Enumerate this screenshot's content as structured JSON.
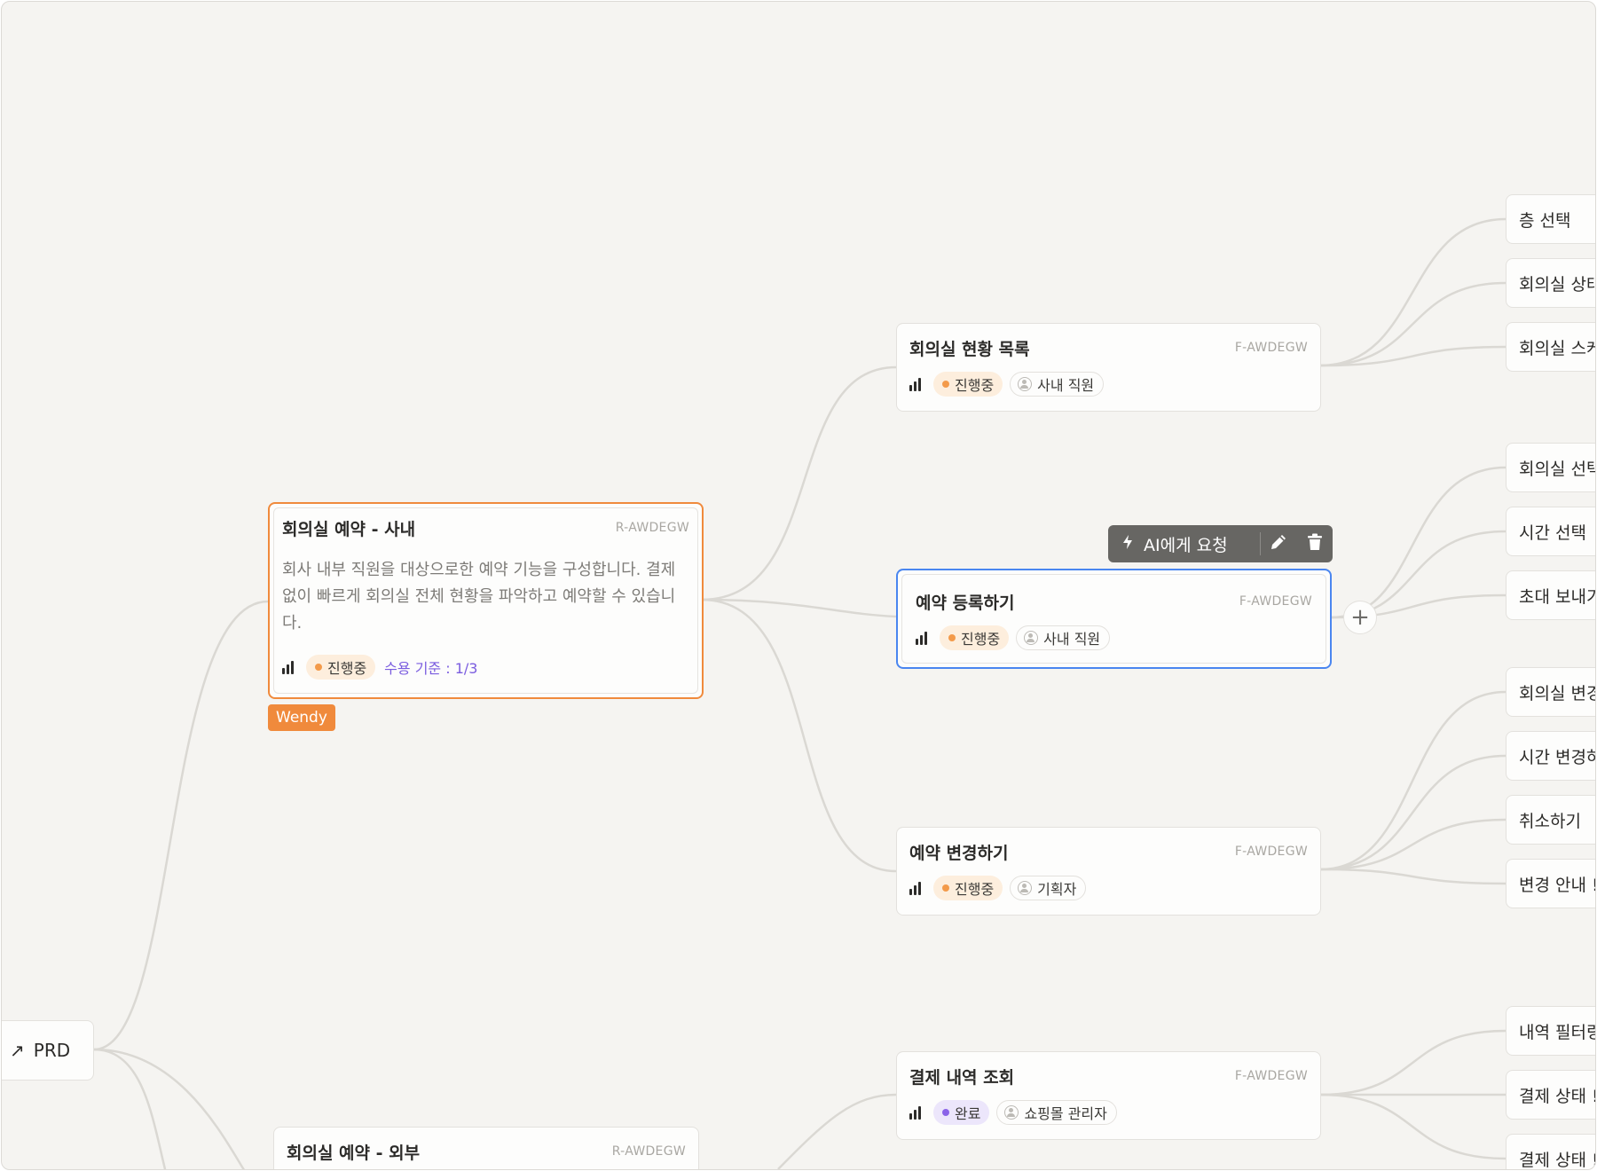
{
  "root": {
    "label": "PRD",
    "arrow_icon": "↗"
  },
  "requirements": [
    {
      "title": "회의실 예약 - 사내",
      "code": "R-AWDEGW",
      "description": "회사 내부 직원을 대상으로한 예약 기능을 구성합니다. 결제 없이 빠르게 회의실 전체 현황을 파악하고 예약할 수 있습니다.",
      "status": "진행중",
      "acceptance": "수용 기준 : 1/3",
      "assignee": "Wendy"
    },
    {
      "title": "회의실 예약 - 외부",
      "code": "R-AWDEGW"
    }
  ],
  "features": [
    {
      "title": "회의실 현황 목록",
      "code": "F-AWDEGW",
      "status": "진행중",
      "role": "사내 직원"
    },
    {
      "title": "예약 등록하기",
      "code": "F-AWDEGW",
      "status": "진행중",
      "role": "사내 직원"
    },
    {
      "title": "예약 변경하기",
      "code": "F-AWDEGW",
      "status": "진행중",
      "role": "기획자"
    },
    {
      "title": "결제 내역 조회",
      "code": "F-AWDEGW",
      "status": "완료",
      "role": "쇼핑몰 관리자"
    }
  ],
  "leaves": [
    "층 선택",
    "회의실 상태",
    "회의실 스케",
    "회의실 선택",
    "시간 선택",
    "초대 보내기",
    "회의실 변경",
    "시간 변경하",
    "취소하기",
    "변경 안내 !",
    "내역 필터링",
    "결제 상태 !",
    "결제 상태 !"
  ],
  "toolbar": {
    "ai_label": "AI에게 요청",
    "bolt_icon": "bolt-icon",
    "edit_icon": "pencil-icon",
    "delete_icon": "trash-icon"
  },
  "add_icon": "+",
  "colors": {
    "canvas": "#f5f4f1",
    "selected_requirement": "#f08a3c",
    "selected_feature": "#4a86f0",
    "in_progress": "#f39a4a",
    "done": "#8a63e8",
    "acceptance_text": "#7a5cdf",
    "edge": "#dad8d3"
  }
}
